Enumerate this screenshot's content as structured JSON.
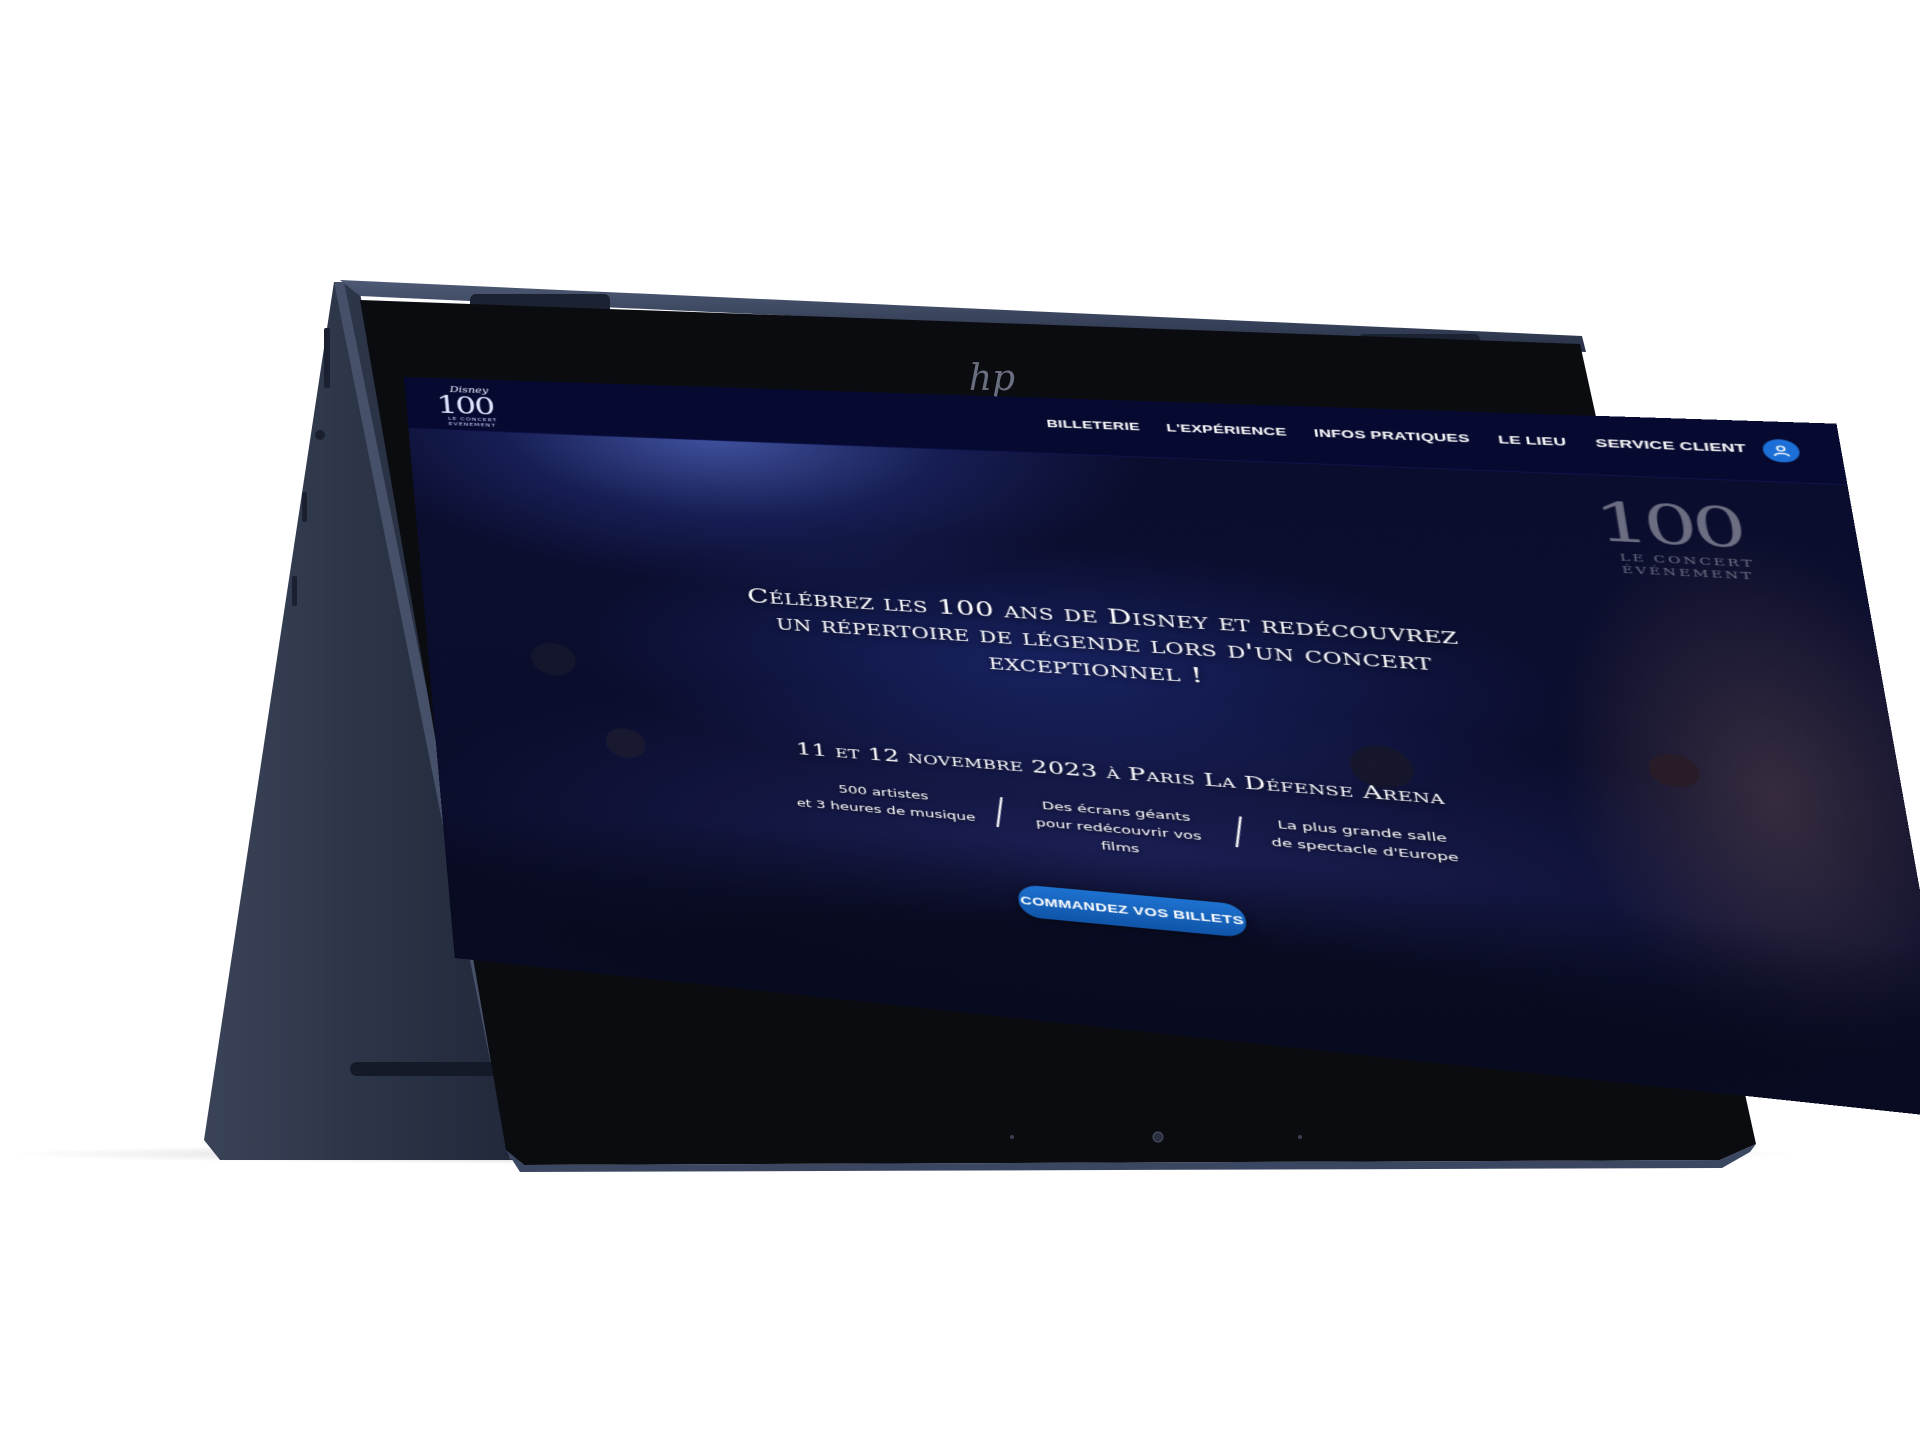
{
  "device": {
    "brand_logo_text": "hp"
  },
  "site": {
    "logo": {
      "script": "Disney",
      "number": "100",
      "line1": "LE CONCERT",
      "line2": "ÉVÉNEMENT"
    },
    "nav": [
      {
        "label": "BILLETERIE"
      },
      {
        "label": "L'EXPÉRIENCE"
      },
      {
        "label": "INFOS PRATIQUES"
      },
      {
        "label": "LE LIEU"
      },
      {
        "label": "SERVICE CLIENT"
      }
    ],
    "account_icon": "user-icon",
    "hero": {
      "watermark": {
        "number": "100",
        "line1": "LE CONCERT",
        "line2": "ÉVÉNEMENT"
      },
      "headline": "Célébrez les 100 ans de Disney et redécouvrez un répertoire de légende lors d'un concert exceptionnel !",
      "date_line": "11 et 12 novembre 2023 à Paris La Défense Arena",
      "features": [
        {
          "line1": "500 artistes",
          "line2": "et 3 heures de musique"
        },
        {
          "line1": "Des écrans géants",
          "line2": "pour redécouvrir vos films"
        },
        {
          "line1": "La plus grande salle",
          "line2": "de spectacle d'Europe"
        }
      ],
      "cta": "COMMANDEZ VOS BILLETS"
    }
  },
  "colors": {
    "nav_bg": "#070a30",
    "accent": "#1d72d0",
    "device_body": "#2a3347"
  }
}
